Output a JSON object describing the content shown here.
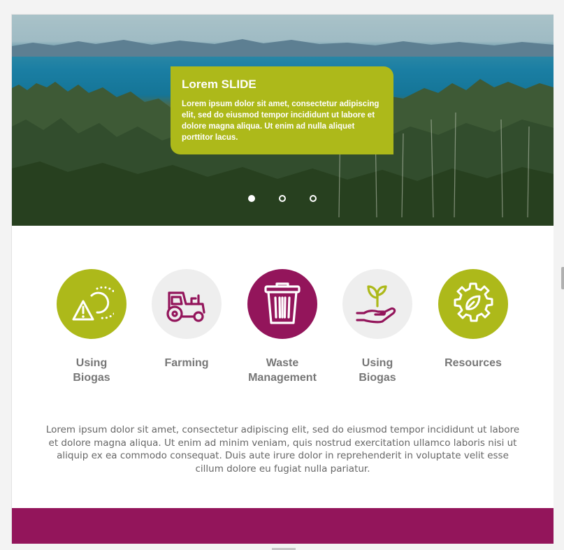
{
  "colors": {
    "accent_green": "#adb91a",
    "accent_magenta": "#93155b",
    "neutral_circle": "#eeeeee",
    "label_gray": "#777777"
  },
  "slider": {
    "title": "Lorem SLIDE",
    "text": "Lorem ipsum dolor sit amet, consectetur adipiscing elit, sed do eiusmod tempor incididunt ut labore et dolore magna aliqua. Ut enim ad nulla aliquet porttitor lacus.",
    "slide_count": 3,
    "active_slide": 1
  },
  "features": [
    {
      "label": "Using\nBiogas",
      "icon": "sun-warning-icon",
      "style": "green"
    },
    {
      "label": "Farming",
      "icon": "tractor-icon",
      "style": "gray"
    },
    {
      "label": "Waste\nManagement",
      "icon": "trash-can-icon",
      "style": "magenta"
    },
    {
      "label": "Using\nBiogas",
      "icon": "hand-sprout-icon",
      "style": "gray"
    },
    {
      "label": "Resources",
      "icon": "gear-leaf-icon",
      "style": "green"
    }
  ],
  "description": "Lorem ipsum dolor sit amet, consectetur adipiscing elit, sed do eiusmod tempor incididunt ut labore et dolore magna aliqua. Ut enim ad minim veniam, quis nostrud exercitation ullamco laboris nisi ut aliquip ex ea commodo consequat. Duis aute irure dolor in reprehenderit in voluptate velit esse cillum dolore eu fugiat nulla pariatur."
}
